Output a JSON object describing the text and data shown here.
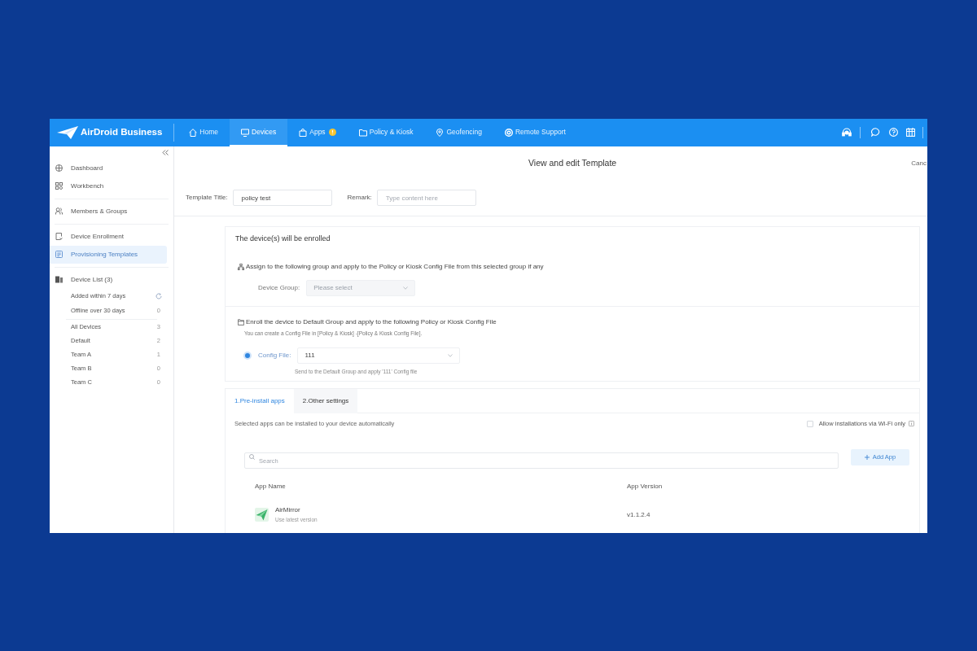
{
  "header": {
    "logo": "AirDroid Business",
    "nav": [
      {
        "label": "Home",
        "selected": false,
        "badge": false
      },
      {
        "label": "Devices",
        "selected": true,
        "badge": false
      },
      {
        "label": "Apps",
        "selected": false,
        "badge": true
      },
      {
        "label": "Policy & Kiosk",
        "selected": false,
        "badge": false
      },
      {
        "label": "Geofencing",
        "selected": false,
        "badge": false
      },
      {
        "label": "Remote Support",
        "selected": false,
        "badge": false
      }
    ]
  },
  "sidebar": {
    "sections": [
      [
        {
          "label": "Dashboard",
          "selected": false
        },
        {
          "label": "Workbench",
          "selected": false
        }
      ],
      [
        {
          "label": "Members & Groups",
          "selected": false
        }
      ],
      [
        {
          "label": "Device Enrollment",
          "selected": false
        },
        {
          "label": "Provisioning Templates",
          "selected": true
        }
      ],
      [
        {
          "label": "Device List (3)",
          "selected": false
        }
      ]
    ],
    "filters": [
      {
        "label": "Added within 7 days",
        "kind": "refresh",
        "selected": false
      },
      {
        "label": "Offline over 30 days",
        "kind": "count",
        "count": "0",
        "selected": false
      }
    ],
    "groups": [
      {
        "label": "All Devices",
        "count": "3",
        "selected": false
      },
      {
        "label": "Default",
        "count": "2",
        "selected": false
      },
      {
        "label": "Team A",
        "count": "1",
        "selected": false
      },
      {
        "label": "Team B",
        "count": "0",
        "selected": false
      },
      {
        "label": "Team C",
        "count": "0",
        "selected": false
      }
    ]
  },
  "page": {
    "title": "View and edit Template",
    "cancel": "Canc"
  },
  "template_form": {
    "fields": [
      {
        "label": "Template Title:",
        "value": "policy test"
      },
      {
        "label": "Remark:",
        "placeholder": "Type content here"
      }
    ]
  },
  "enrollment": {
    "heading": "The device(s) will be enrolled",
    "group_option": {
      "text": "Assign to the following group and apply to the Policy or Kiosk Config File from this selected group if any",
      "field": {
        "label": "Device Group:",
        "placeholder": "Please select",
        "disabled": true
      }
    },
    "config_option": {
      "text": "Enroll the device to Default Group and apply to the following Policy or Kiosk Config File",
      "note": "You can create a Config File in [Policy & Kiosk] -[Policy & Kiosk Config File].",
      "field": {
        "label": "Config File:",
        "value": "111",
        "selected": true
      },
      "helper": "Send to the Default Group and apply '111' Config file"
    }
  },
  "tabs": [
    {
      "label": "1.Pre-install apps",
      "selected": true
    },
    {
      "label": "2.Other settings",
      "selected": false
    }
  ],
  "apps": {
    "description": "Selected apps can be installed to your device automatically",
    "wifi_only": {
      "label": "Allow installations via Wi-Fi only",
      "checked": false
    },
    "search": {
      "placeholder": "Search"
    },
    "add_button": "Add App",
    "table": {
      "columns": [
        "App Name",
        "App Version"
      ],
      "rows": [
        {
          "name": "AirMirror",
          "note": "Use latest version",
          "version": "v1.1.2.4"
        }
      ]
    }
  }
}
